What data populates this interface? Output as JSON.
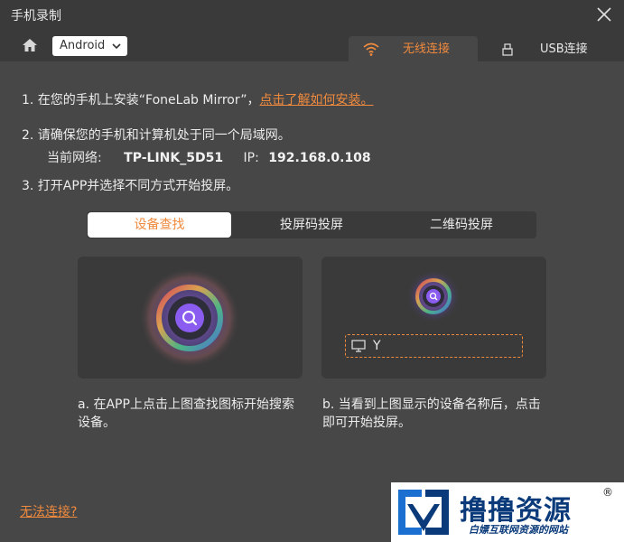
{
  "window": {
    "title": "手机录制"
  },
  "toolbar": {
    "os_selected": "Android",
    "tabs": [
      {
        "label": "无线连接",
        "icon": "wifi-icon",
        "active": true
      },
      {
        "label": "USB连接",
        "icon": "usb-icon",
        "active": false
      }
    ]
  },
  "steps": {
    "s1_text": "1. 在您的手机上安装“FoneLab Mirror”，",
    "s1_link": "点击了解如何安装。",
    "s2_text": "2. 请确保您的手机和计算机处于同一个局域网。",
    "network_label": "当前网络:",
    "network_name": "TP-LINK_5D51",
    "ip_label": "IP:",
    "ip_value": "192.168.0.108",
    "s3_text": "3. 打开APP并选择不同方式开始投屏。"
  },
  "modes": [
    {
      "label": "设备查找",
      "active": true
    },
    {
      "label": "投屏码投屏",
      "active": false
    },
    {
      "label": "二维码投屏",
      "active": false
    }
  ],
  "device": {
    "name": "Y"
  },
  "descriptions": {
    "a_line1": "a. 在APP上点击上图查找图标开始搜索",
    "a_line2": "设备。",
    "b_line1": "b. 当看到上图显示的设备名称后，点击",
    "b_line2": "即可开始投屏。"
  },
  "help_link": "无法连接?",
  "watermark": {
    "title": "撸撸资源",
    "registered": "®",
    "subtitle": "白嫖互联网资源的网站"
  },
  "colors": {
    "accent": "#ef8a3e",
    "panel": "#474747",
    "titlebar": "#3a3a3a"
  }
}
